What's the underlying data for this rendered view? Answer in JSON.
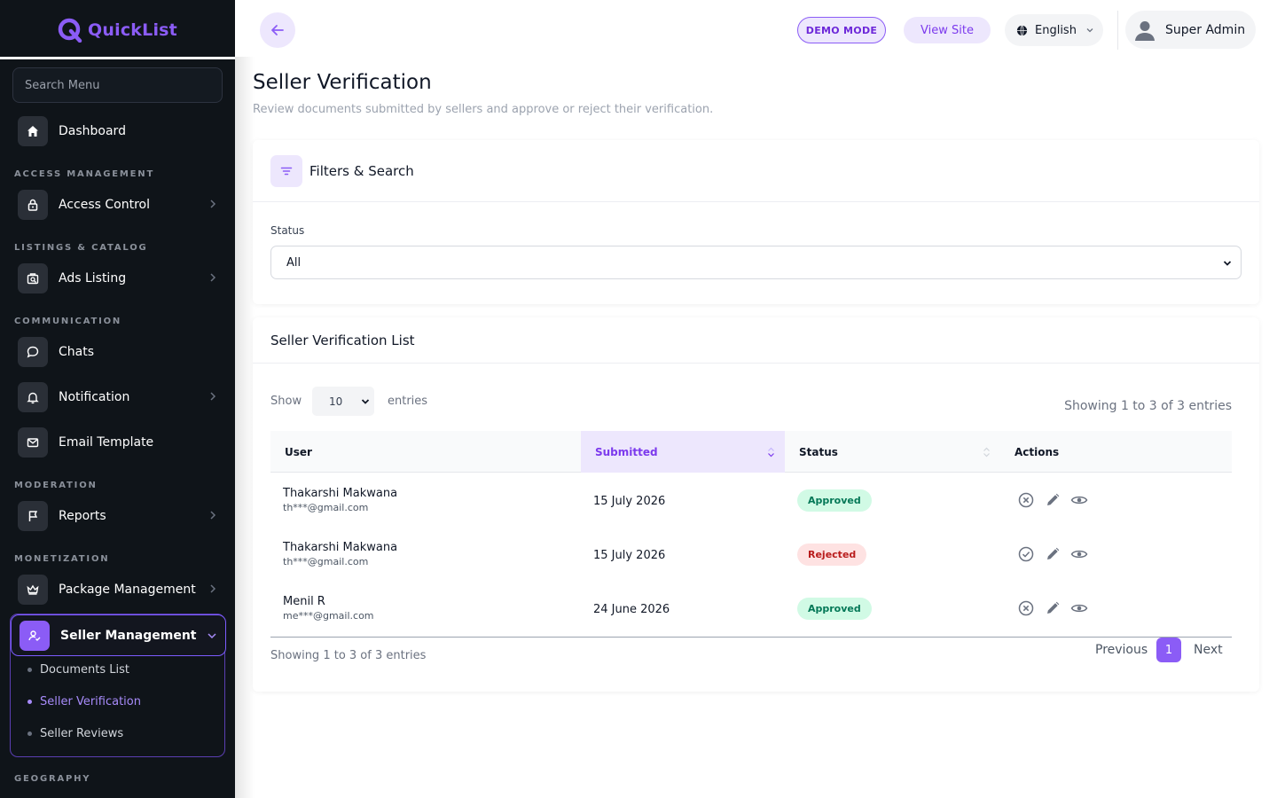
{
  "colors": {
    "sidebar_bg": "#0f1419",
    "accent": "#8b5cf6",
    "approved": "#047857",
    "rejected": "#b91c1c"
  },
  "brand": {
    "name": "QuickList",
    "icon": "quicklist-logo-icon"
  },
  "sidebar": {
    "search_placeholder": "Search Menu",
    "dashboard": "Dashboard",
    "sections": {
      "access": "ACCESS MANAGEMENT",
      "listings": "LISTINGS & CATALOG",
      "communication": "COMMUNICATION",
      "moderation": "MODERATION",
      "monetization": "MONETIZATION",
      "geography": "GEOGRAPHY"
    },
    "items": {
      "access_control": "Access Control",
      "ads_listing": "Ads Listing",
      "chats": "Chats",
      "notification": "Notification",
      "email_template": "Email Template",
      "reports": "Reports",
      "package_management": "Package Management",
      "seller_management": "Seller Management"
    },
    "seller_sub": {
      "documents_list": "Documents List",
      "seller_verification": "Seller Verification",
      "seller_reviews": "Seller Reviews"
    }
  },
  "topbar": {
    "demo_mode": "DEMO MODE",
    "view_site": "View Site",
    "language": "English",
    "user": "Super Admin"
  },
  "page": {
    "title": "Seller Verification",
    "subtitle": "Review documents submitted by sellers and approve or reject their verification."
  },
  "filters": {
    "title": "Filters & Search",
    "status_label": "Status",
    "status_value": "All"
  },
  "list": {
    "title": "Seller Verification List",
    "show_label": "Show",
    "entries_value": "10",
    "entries_label": "entries",
    "showing": "Showing 1 to 3 of 3 entries",
    "columns": {
      "user": "User",
      "submitted": "Submitted",
      "status": "Status",
      "actions": "Actions"
    },
    "rows": [
      {
        "name": "Thakarshi Makwana",
        "email": "th***@gmail.com",
        "submitted": "15 July 2026",
        "status": "Approved"
      },
      {
        "name": "Thakarshi Makwana",
        "email": "th***@gmail.com",
        "submitted": "15 July 2026",
        "status": "Rejected"
      },
      {
        "name": "Menil R",
        "email": "me***@gmail.com",
        "submitted": "24 June 2026",
        "status": "Approved"
      }
    ],
    "pagination": {
      "previous": "Previous",
      "current": "1",
      "next": "Next"
    }
  }
}
